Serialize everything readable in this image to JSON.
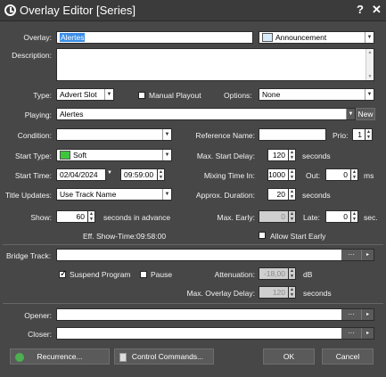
{
  "window": {
    "title": "Overlay Editor [Series]",
    "help": "?",
    "close": "✕"
  },
  "colors": {
    "window_bg": "#474747",
    "announcement_swatch": "#d7ecf8",
    "soft_swatch": "#3cc63c",
    "recurrence_icon": "#4caf50"
  },
  "overlay": {
    "label": "Overlay:",
    "value": "Alertes",
    "category": "Announcement"
  },
  "description": {
    "label": "Description:",
    "value": ""
  },
  "type": {
    "label": "Type:",
    "value": "Advert Slot",
    "manual_playout": "Manual Playout",
    "options_label": "Options:",
    "options_value": "None"
  },
  "playing": {
    "label": "Playing:",
    "value": "Alertes",
    "new_btn": "New"
  },
  "condition": {
    "label": "Condition:",
    "value": "",
    "ref_label": "Reference Name:",
    "ref_value": "",
    "prio_label": "Prio:",
    "prio_value": "1"
  },
  "start_type": {
    "label": "Start Type:",
    "value": "Soft",
    "max_delay_label": "Max. Start Delay:",
    "max_delay_value": "120",
    "unit": "seconds"
  },
  "start_time": {
    "label": "Start Time:",
    "date": "02/04/2024",
    "time": "09:59:00",
    "mix_label": "Mixing Time In:",
    "mix_value": "1000",
    "out_label": "Out:",
    "out_value": "0",
    "unit": "ms"
  },
  "title_updates": {
    "label": "Title Updates:",
    "value": "Use Track Name",
    "approx_label": "Approx. Duration:",
    "approx_value": "20",
    "unit": "seconds"
  },
  "show": {
    "label": "Show:",
    "value": "60",
    "suffix": "seconds in advance",
    "early_label": "Max. Early:",
    "early_value": "0",
    "late_label": "Late:",
    "late_value": "0",
    "unit": "sec.",
    "eff_label": "Eff. Show-Time:",
    "eff_value": "09:58:00",
    "allow_early": "Allow Start Early"
  },
  "bridge": {
    "label": "Bridge Track:",
    "value": "",
    "ellipsis": "···",
    "arrow": "▸"
  },
  "suspend": {
    "suspend_label": "Suspend Program",
    "pause_label": "Pause",
    "atten_label": "Attenuation:",
    "atten_value": "-18,00",
    "atten_unit": "dB",
    "overlay_delay_label": "Max. Overlay Delay:",
    "overlay_delay_value": "120",
    "overlay_delay_unit": "seconds"
  },
  "opener": {
    "label": "Opener:",
    "value": ""
  },
  "closer": {
    "label": "Closer:",
    "value": ""
  },
  "buttons": {
    "recurrence": "Recurrence...",
    "control": "Control Commands...",
    "ok": "OK",
    "cancel": "Cancel"
  },
  "icons": {
    "title": "clock-icon",
    "recurrence": "recurrence-icon",
    "control": "document-icon"
  }
}
